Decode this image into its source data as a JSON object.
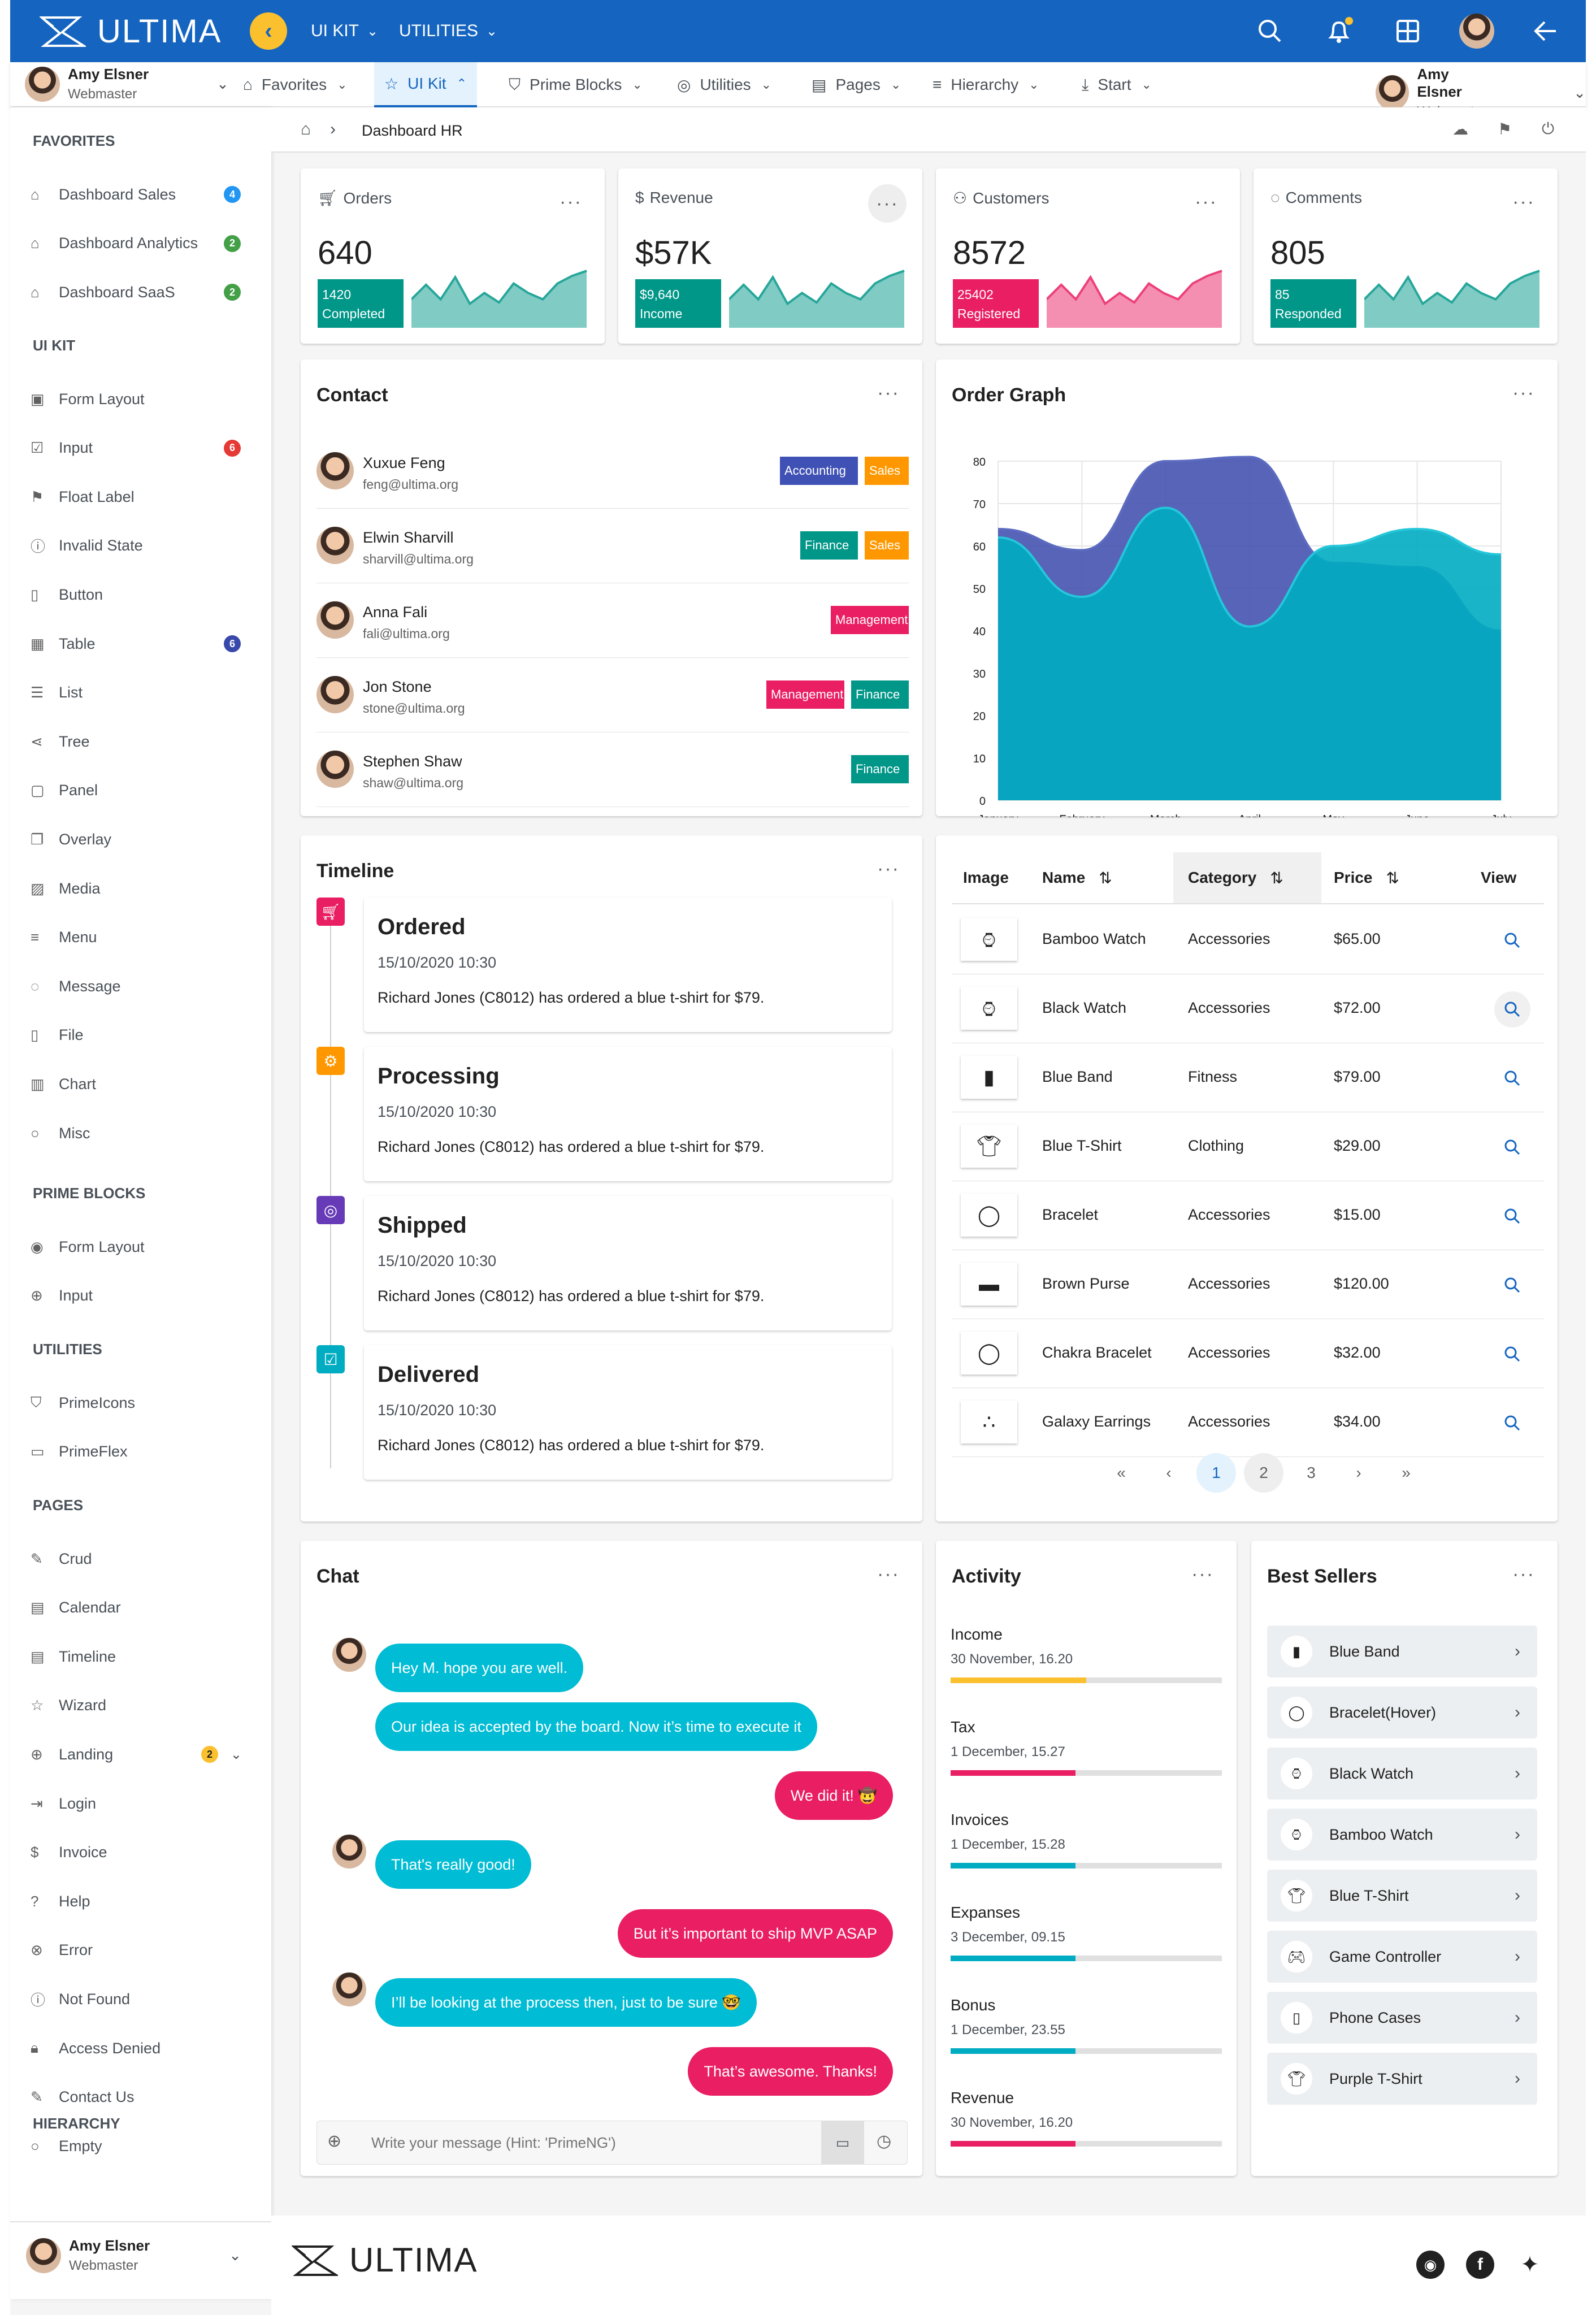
{
  "app": {
    "name": "ULTIMA"
  },
  "topbar": {
    "menus": [
      "UI KIT",
      "UTILITIES"
    ]
  },
  "menubar": {
    "user": {
      "name": "Amy Elsner",
      "role": "Webmaster"
    },
    "items": [
      "Favorites",
      "UI Kit",
      "Prime Blocks",
      "Utilities",
      "Pages",
      "Hierarchy",
      "Start"
    ]
  },
  "sidebar": {
    "sections": {
      "favorites": "FAVORITES",
      "uikit": "UI KIT",
      "primeblocks": "PRIME BLOCKS",
      "utilities": "UTILITIES",
      "pages": "PAGES",
      "hierarchy": "HIERARCHY"
    },
    "favorites": [
      {
        "label": "Dashboard Sales",
        "badge": "4",
        "badge_color": "#2196f3",
        "icon": "home-icon"
      },
      {
        "label": "Dashboard Analytics",
        "badge": "2",
        "badge_color": "#43a047",
        "icon": "home-icon"
      },
      {
        "label": "Dashboard SaaS",
        "badge": "2",
        "badge_color": "#43a047",
        "icon": "home-icon"
      }
    ],
    "uikit": [
      {
        "label": "Form Layout",
        "icon": "id-card-icon"
      },
      {
        "label": "Input",
        "badge": "6",
        "badge_color": "#e53935",
        "icon": "check-square-icon"
      },
      {
        "label": "Float Label",
        "icon": "bookmark-icon"
      },
      {
        "label": "Invalid State",
        "icon": "exclamation-circle-icon"
      },
      {
        "label": "Button",
        "icon": "mobile-icon"
      },
      {
        "label": "Table",
        "badge": "6",
        "badge_color": "#3949ab",
        "icon": "table-icon"
      },
      {
        "label": "List",
        "icon": "list-icon"
      },
      {
        "label": "Tree",
        "icon": "share-icon"
      },
      {
        "label": "Panel",
        "icon": "tablet-icon"
      },
      {
        "label": "Overlay",
        "icon": "clone-icon"
      },
      {
        "label": "Media",
        "icon": "image-icon"
      },
      {
        "label": "Menu",
        "icon": "bars-icon"
      },
      {
        "label": "Message",
        "icon": "comment-icon"
      },
      {
        "label": "File",
        "icon": "file-icon"
      },
      {
        "label": "Chart",
        "icon": "chart-bar-icon"
      },
      {
        "label": "Misc",
        "icon": "circle-icon"
      }
    ],
    "primeblocks": [
      {
        "label": "Form Layout",
        "icon": "eye-icon"
      },
      {
        "label": "Input",
        "icon": "globe-icon"
      }
    ],
    "utilities": [
      {
        "label": "PrimeIcons",
        "icon": "prime-icon"
      },
      {
        "label": "PrimeFlex",
        "icon": "desktop-icon"
      }
    ],
    "pages": [
      {
        "label": "Crud",
        "icon": "pencil-icon"
      },
      {
        "label": "Calendar",
        "icon": "calendar-icon"
      },
      {
        "label": "Timeline",
        "icon": "calendar-icon"
      },
      {
        "label": "Wizard",
        "icon": "star-icon"
      },
      {
        "label": "Landing",
        "badge": "2",
        "badge_color": "#fbc02d",
        "icon": "globe-icon"
      },
      {
        "label": "Login",
        "icon": "sign-in-icon"
      },
      {
        "label": "Invoice",
        "icon": "dollar-icon"
      },
      {
        "label": "Help",
        "icon": "question-circle-icon"
      },
      {
        "label": "Error",
        "icon": "times-circle-icon"
      },
      {
        "label": "Not Found",
        "icon": "exclamation-circle-icon"
      },
      {
        "label": "Access Denied",
        "icon": "lock-icon"
      },
      {
        "label": "Contact Us",
        "icon": "pencil-icon"
      },
      {
        "label": "Empty",
        "icon": "circle-icon"
      }
    ],
    "footer_user": {
      "name": "Amy Elsner",
      "role": "Webmaster"
    }
  },
  "breadcrumb": {
    "page": "Dashboard HR"
  },
  "kpis": [
    {
      "title": "Orders",
      "value": "640",
      "sub_value": "1420",
      "sub_label": "Completed",
      "color": "#009688",
      "area": "#80cbc4",
      "stroke": "#26a69a"
    },
    {
      "title": "Revenue",
      "value": "$57K",
      "sub_value": "$9,640",
      "sub_label": "Income",
      "color": "#009688",
      "area": "#80cbc4",
      "stroke": "#26a69a"
    },
    {
      "title": "Customers",
      "value": "8572",
      "sub_value": "25402",
      "sub_label": "Registered",
      "color": "#e91e63",
      "area": "#f48fb1",
      "stroke": "#ec407a"
    },
    {
      "title": "Comments",
      "value": "805",
      "sub_value": "85",
      "sub_label": "Responded",
      "color": "#009688",
      "area": "#80cbc4",
      "stroke": "#26a69a"
    }
  ],
  "contact": {
    "title": "Contact",
    "people": [
      {
        "name": "Xuxue Feng",
        "email": "feng@ultima.org",
        "tags": [
          {
            "label": "Accounting",
            "color": "#3f51b5"
          },
          {
            "label": "Sales",
            "color": "#ff9800"
          }
        ]
      },
      {
        "name": "Elwin Sharvill",
        "email": "sharvill@ultima.org",
        "tags": [
          {
            "label": "Finance",
            "color": "#009688"
          },
          {
            "label": "Sales",
            "color": "#ff9800"
          }
        ]
      },
      {
        "name": "Anna Fali",
        "email": "fali@ultima.org",
        "tags": [
          {
            "label": "Management",
            "color": "#e91e63"
          }
        ]
      },
      {
        "name": "Jon Stone",
        "email": "stone@ultima.org",
        "tags": [
          {
            "label": "Management",
            "color": "#e91e63"
          },
          {
            "label": "Finance",
            "color": "#009688"
          }
        ]
      },
      {
        "name": "Stephen Shaw",
        "email": "shaw@ultima.org",
        "tags": [
          {
            "label": "Finance",
            "color": "#009688"
          }
        ]
      }
    ]
  },
  "order_graph": {
    "title": "Order Graph"
  },
  "chart_data": {
    "type": "area",
    "categories": [
      "January",
      "February",
      "March",
      "April",
      "May",
      "June",
      "July"
    ],
    "ylim": [
      0,
      80
    ],
    "yticks": [
      0,
      10,
      20,
      30,
      40,
      50,
      60,
      70,
      80
    ],
    "series": [
      {
        "values": [
          64,
          59,
          80,
          81,
          56,
          55,
          40
        ],
        "color": "#5c6bc0",
        "fill": "#3949ab"
      },
      {
        "values": [
          62,
          48,
          69,
          41,
          60,
          64,
          58
        ],
        "color": "#26c6da",
        "fill": "#00acc1"
      }
    ]
  },
  "timeline": {
    "title": "Timeline",
    "events": [
      {
        "status": "Ordered",
        "date": "15/10/2020 10:30",
        "text": "Richard Jones (C8012) has ordered a blue t-shirt for $79.",
        "color": "#e91e63",
        "icon": "shopping-cart-icon"
      },
      {
        "status": "Processing",
        "date": "15/10/2020 10:30",
        "text": "Richard Jones (C8012) has ordered a blue t-shirt for $79.",
        "color": "#ff9800",
        "icon": "cog-icon"
      },
      {
        "status": "Shipped",
        "date": "15/10/2020 10:30",
        "text": "Richard Jones (C8012) has ordered a blue t-shirt for $79.",
        "color": "#673ab7",
        "icon": "compass-icon"
      },
      {
        "status": "Delivered",
        "date": "15/10/2020 10:30",
        "text": "Richard Jones (C8012) has ordered a blue t-shirt for $79.",
        "color": "#00acc1",
        "icon": "check-square-icon"
      }
    ]
  },
  "products": {
    "columns": {
      "image": "Image",
      "name": "Name",
      "category": "Category",
      "price": "Price",
      "view": "View"
    },
    "rows": [
      {
        "name": "Bamboo Watch",
        "category": "Accessories",
        "price": "$65.00",
        "thumb": "watch-thumb"
      },
      {
        "name": "Black Watch",
        "category": "Accessories",
        "price": "$72.00",
        "thumb": "watch-thumb"
      },
      {
        "name": "Blue Band",
        "category": "Fitness",
        "price": "$79.00",
        "thumb": "band-thumb"
      },
      {
        "name": "Blue T-Shirt",
        "category": "Clothing",
        "price": "$29.00",
        "thumb": "tshirt-thumb"
      },
      {
        "name": "Bracelet",
        "category": "Accessories",
        "price": "$15.00",
        "thumb": "bracelet-thumb"
      },
      {
        "name": "Brown Purse",
        "category": "Accessories",
        "price": "$120.00",
        "thumb": "purse-thumb"
      },
      {
        "name": "Chakra Bracelet",
        "category": "Accessories",
        "price": "$32.00",
        "thumb": "bracelet-thumb"
      },
      {
        "name": "Galaxy Earrings",
        "category": "Accessories",
        "price": "$34.00",
        "thumb": "earrings-thumb"
      }
    ],
    "pages": [
      "1",
      "2",
      "3"
    ],
    "current_page": "1"
  },
  "chat": {
    "title": "Chat",
    "messages": [
      {
        "from": "them",
        "text": "Hey M. hope you are well."
      },
      {
        "from": "them",
        "text": "Our idea is accepted by the board. Now it’s time to execute it"
      },
      {
        "from": "me",
        "text": "We did it! 🤠"
      },
      {
        "from": "them",
        "text": "That's really good!"
      },
      {
        "from": "me",
        "text": "But it’s important to ship MVP ASAP"
      },
      {
        "from": "them",
        "text": "I’ll be looking at the process then, just to be sure 🤓"
      },
      {
        "from": "me",
        "text": "That’s awesome. Thanks!"
      }
    ],
    "placeholder": "Write your message (Hint: 'PrimeNG')"
  },
  "activity": {
    "title": "Activity",
    "items": [
      {
        "label": "Income",
        "date": "30 November, 16.20",
        "progress": 0.5,
        "color": "#fbc02d"
      },
      {
        "label": "Tax",
        "date": "1 December, 15.27",
        "progress": 0.46,
        "color": "#e91e63"
      },
      {
        "label": "Invoices",
        "date": "1 December, 15.28",
        "progress": 0.46,
        "color": "#00acc1"
      },
      {
        "label": "Expanses",
        "date": "3 December, 09.15",
        "progress": 0.46,
        "color": "#00acc1"
      },
      {
        "label": "Bonus",
        "date": "1 December, 23.55",
        "progress": 0.46,
        "color": "#00acc1"
      },
      {
        "label": "Revenue",
        "date": "30 November, 16.20",
        "progress": 0.46,
        "color": "#e91e63"
      }
    ]
  },
  "best_sellers": {
    "title": "Best Sellers",
    "items": [
      "Blue Band",
      "Bracelet(Hover)",
      "Black Watch",
      "Bamboo Watch",
      "Blue T-Shirt",
      "Game Controller",
      "Phone Cases",
      "Purple T-Shirt"
    ]
  },
  "footer": {
    "brand": "ULTIMA"
  }
}
